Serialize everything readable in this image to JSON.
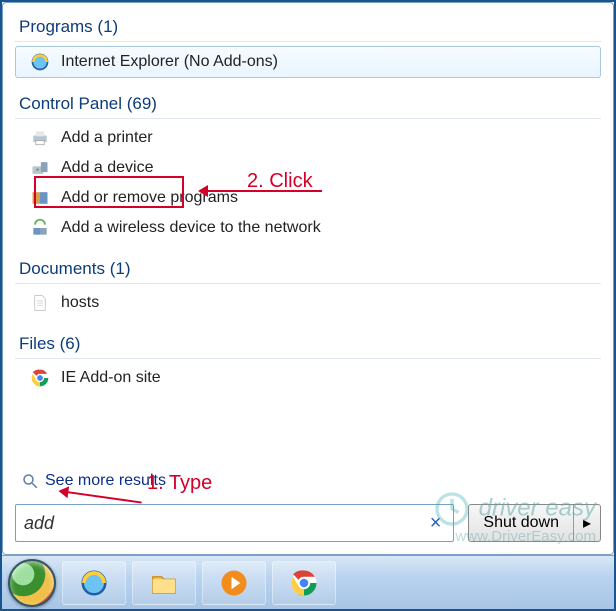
{
  "sections": {
    "programs": {
      "header": "Programs (1)",
      "items": [
        {
          "label": "Internet Explorer (No Add-ons)",
          "icon": "ie"
        }
      ]
    },
    "controlPanel": {
      "header": "Control Panel (69)",
      "items": [
        {
          "label": "Add a printer",
          "icon": "printer"
        },
        {
          "label": "Add a device",
          "icon": "device"
        },
        {
          "label": "Add or remove programs",
          "icon": "programs"
        },
        {
          "label": "Add a wireless device to the network",
          "icon": "wireless"
        }
      ]
    },
    "documents": {
      "header": "Documents (1)",
      "items": [
        {
          "label": "hosts",
          "icon": "file"
        }
      ]
    },
    "files": {
      "header": "Files (6)",
      "items": [
        {
          "label": "IE Add-on site",
          "icon": "chrome"
        }
      ]
    }
  },
  "seeMore": "See more results",
  "search": {
    "value": "add",
    "clearGlyph": "×"
  },
  "shutdown": {
    "label": "Shut down",
    "arrowGlyph": "▸"
  },
  "annotations": {
    "step1": "1. Type",
    "step2": "2. Click"
  },
  "watermark": {
    "line1": "driver easy",
    "line2": "www.DriverEasy.com"
  },
  "taskbar": {
    "buttons": [
      "ie",
      "explorer",
      "wmp",
      "chrome"
    ]
  }
}
